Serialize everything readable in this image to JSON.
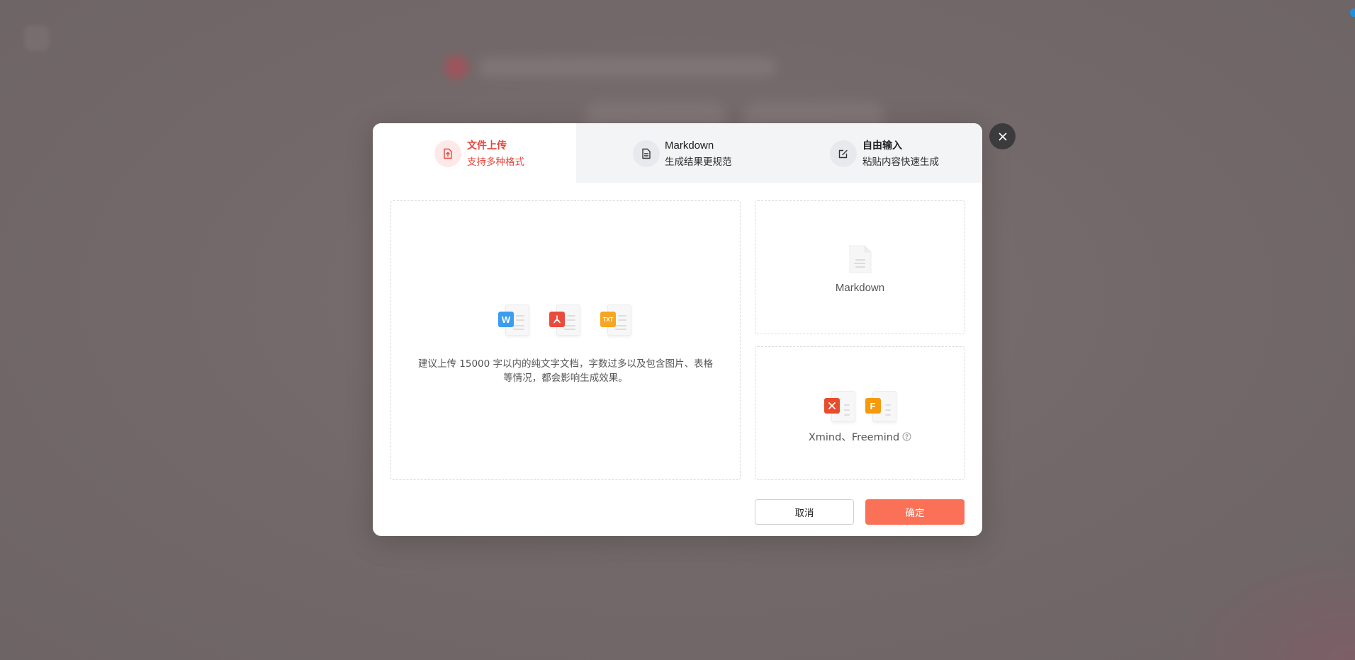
{
  "modal": {
    "tabs": [
      {
        "title": "文件上传",
        "subtitle": "支持多种格式",
        "icon": "file-upload-icon",
        "active": true
      },
      {
        "title": "Markdown",
        "subtitle": "生成结果更规范",
        "icon": "document-icon",
        "active": false
      },
      {
        "title": "自由输入",
        "subtitle": "粘贴内容快速生成",
        "icon": "edit-icon",
        "active": false
      }
    ],
    "upload": {
      "file_types": [
        {
          "badge": "W",
          "icon": "word-file-icon"
        },
        {
          "badge": "",
          "icon": "pdf-file-icon"
        },
        {
          "badge": "TXT",
          "icon": "txt-file-icon"
        }
      ],
      "hint_line1": "建议上传 15000 字以内的纯文字文档，字数过多以及包含图片、表格",
      "hint_line2": "等情况，都会影响生成效果。"
    },
    "markdown_option": {
      "label": "Markdown",
      "icon": "markdown-file-icon"
    },
    "mindmap_option": {
      "label": "Xmind、Freemind",
      "icons": [
        {
          "badge": "",
          "icon": "xmind-file-icon"
        },
        {
          "badge": "F",
          "icon": "freemind-file-icon"
        }
      ]
    },
    "buttons": {
      "cancel": "取消",
      "ok": "确定"
    }
  },
  "colors": {
    "accent": "#e5483d",
    "primary_button": "#fb7158",
    "overlay": "#726869"
  }
}
